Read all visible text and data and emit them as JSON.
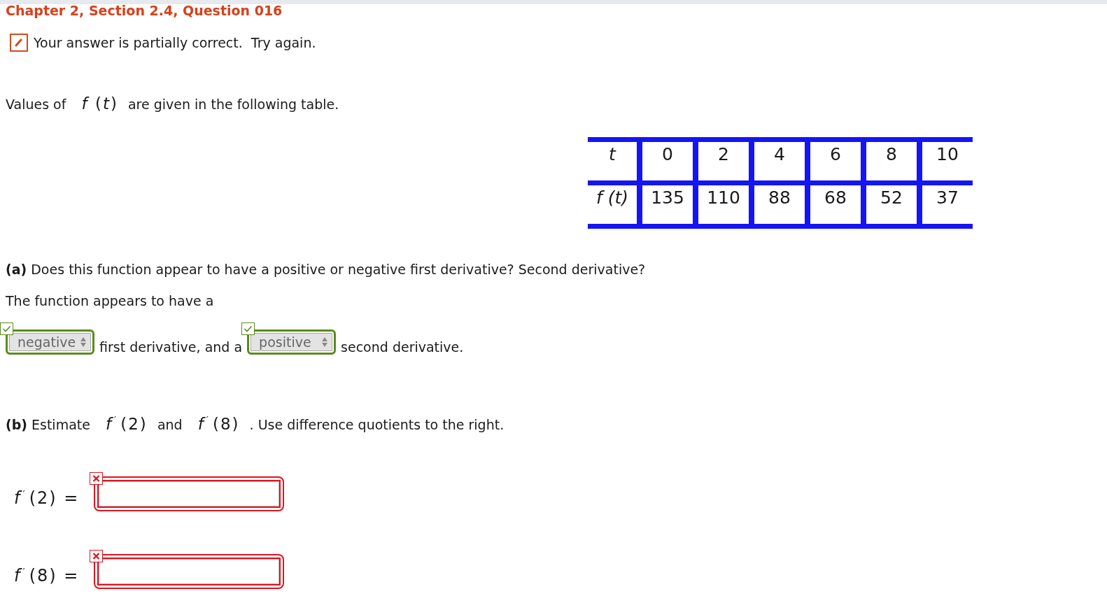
{
  "page": {
    "title": "Chapter 2, Section 2.4, Question 016"
  },
  "feedback": {
    "kind": "partial",
    "text": "Your answer is partially correct.  Try again."
  },
  "intro": [
    {
      "kind": "text",
      "text": "Values of"
    },
    {
      "kind": "math",
      "text": "*f* (*t*)"
    },
    {
      "kind": "text",
      "text": "are given in the following table."
    }
  ],
  "table": {
    "rows": [
      {
        "label": "t",
        "cells": [
          "0",
          "2",
          "4",
          "6",
          "8",
          "10"
        ]
      },
      {
        "label": "f (t)",
        "cells": [
          "135",
          "110",
          "88",
          "68",
          "52",
          "37"
        ]
      }
    ]
  },
  "part_a": {
    "question": "**(a)** Does this function appear to have a positive or negative first derivative? Second derivative?",
    "lead": "The function appears to have a",
    "parts": [
      {
        "kind": "select",
        "value": "negative",
        "correct": true
      },
      {
        "kind": "text",
        "text": "first derivative, and a"
      },
      {
        "kind": "select",
        "value": "positive",
        "correct": true
      },
      {
        "kind": "text",
        "text": "second derivative."
      }
    ]
  },
  "part_b": {
    "question": [
      {
        "kind": "text",
        "text": "**(b)** Estimate"
      },
      {
        "kind": "math",
        "text": "*f*$^{′}$(2)"
      },
      {
        "kind": "text",
        "text": "and"
      },
      {
        "kind": "math",
        "text": "*f*$^{′}$(8)"
      },
      {
        "kind": "text",
        "text": ". Use difference quotients to the right."
      }
    ],
    "answers": [
      {
        "label": "*f*$^{′}$(2) =",
        "correct": false
      },
      {
        "label": "*f*$^{′}$(8) =",
        "correct": false
      }
    ]
  }
}
